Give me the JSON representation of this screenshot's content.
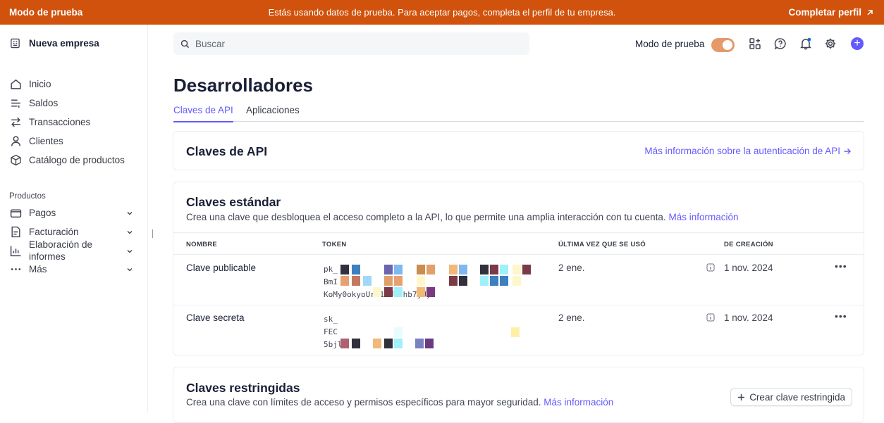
{
  "banner": {
    "mode": "Modo de prueba",
    "message": "Estás usando datos de prueba. Para aceptar pagos, completa el perfil de tu empresa.",
    "complete_profile": "Completar perfil",
    "color": "#d0520c"
  },
  "sidebar": {
    "account_name": "Nueva empresa",
    "items": [
      {
        "label": "Inicio",
        "icon": "home-icon"
      },
      {
        "label": "Saldos",
        "icon": "balances-icon"
      },
      {
        "label": "Transacciones",
        "icon": "transactions-icon"
      },
      {
        "label": "Clientes",
        "icon": "customers-icon"
      },
      {
        "label": "Catálogo de productos",
        "icon": "product-catalog-icon"
      }
    ],
    "section_label": "Productos",
    "product_items": [
      {
        "label": "Pagos",
        "icon": "payments-icon"
      },
      {
        "label": "Facturación",
        "icon": "billing-icon"
      },
      {
        "label": "Elaboración de informes",
        "icon": "reports-icon"
      },
      {
        "label": "Más",
        "icon": "more-icon"
      }
    ]
  },
  "topbar": {
    "search_placeholder": "Buscar",
    "test_mode_label": "Modo de prueba",
    "test_mode_on": true
  },
  "page": {
    "title": "Desarrolladores",
    "tabs": [
      {
        "label": "Claves de API",
        "active": true
      },
      {
        "label": "Aplicaciones",
        "active": false
      }
    ]
  },
  "api_keys_card": {
    "title": "Claves de API",
    "auth_link": "Más información sobre la autenticación de API"
  },
  "standard_keys": {
    "title": "Claves estándar",
    "description": "Crea una clave que desbloquea el acceso completo a la API, lo que permite una amplia interacción con tu cuenta.",
    "more_info": "Más información",
    "columns": [
      "NOMBRE",
      "TOKEN",
      "ÚLTIMA VEZ QUE SE USÓ",
      "DE CREACIÓN"
    ],
    "rows": [
      {
        "name": "Clave publicable",
        "token_lines": [
          "pk_",
          "BmI",
          "KoMy0okyoUrK10UTihb7jUy"
        ],
        "last_used": "2 ene.",
        "created": "1 nov. 2024"
      },
      {
        "name": "Clave secreta",
        "token_lines": [
          "sk_",
          "FEC",
          "5bjl"
        ],
        "last_used": "2 ene.",
        "created": "1 nov. 2024"
      }
    ]
  },
  "restricted_keys": {
    "title": "Claves restringidas",
    "description": "Crea una clave con límites de acceso y permisos específicos para mayor seguridad.",
    "more_info": "Más información",
    "create_button": "Crear clave restringida"
  },
  "colors": {
    "accent": "#635bff",
    "toggle": "#e59a6a"
  }
}
